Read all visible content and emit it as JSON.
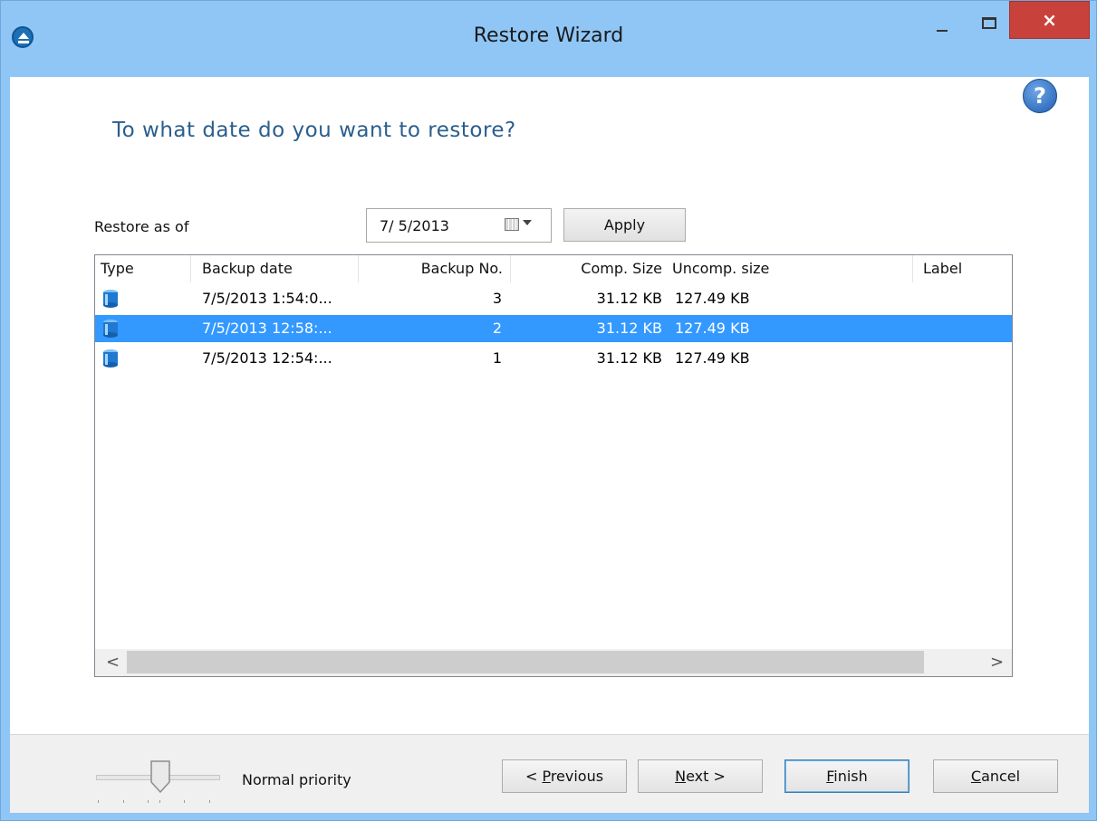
{
  "window": {
    "title": "Restore Wizard",
    "close_glyph": "×"
  },
  "help": {
    "glyph": "?"
  },
  "heading": "To what date do you want to restore?",
  "restore_as_of": {
    "label": "Restore as of",
    "date_value": "7/ 5/2013",
    "apply_label": "Apply"
  },
  "list": {
    "columns": [
      "Type",
      "Backup date",
      "Backup No.",
      "Comp. Size",
      "Uncomp. size",
      "Label"
    ],
    "rows": [
      {
        "type_icon": "database-icon",
        "backup_date": "7/5/2013 1:54:0...",
        "backup_no": "3",
        "comp_size": "31.12 KB",
        "uncomp_size": "127.49 KB",
        "label": "",
        "selected": false
      },
      {
        "type_icon": "database-icon",
        "backup_date": "7/5/2013 12:58:...",
        "backup_no": "2",
        "comp_size": "31.12 KB",
        "uncomp_size": "127.49 KB",
        "label": "",
        "selected": true
      },
      {
        "type_icon": "database-icon",
        "backup_date": "7/5/2013 12:54:...",
        "backup_no": "1",
        "comp_size": "31.12 KB",
        "uncomp_size": "127.49 KB",
        "label": "",
        "selected": false
      }
    ],
    "scroll_left": "<",
    "scroll_right": ">"
  },
  "footer": {
    "priority_label": "Normal priority",
    "previous_prefix": "< ",
    "previous_mnemonic": "P",
    "previous_rest": "revious",
    "next_mnemonic": "N",
    "next_rest": "ext >",
    "finish_mnemonic": "F",
    "finish_rest": "inish",
    "cancel_mnemonic": "C",
    "cancel_rest": "ancel"
  },
  "colors": {
    "titlebar": "#8fc6f6",
    "close_button": "#c8413a",
    "heading": "#2a5e8e",
    "selection": "#3399ff"
  }
}
